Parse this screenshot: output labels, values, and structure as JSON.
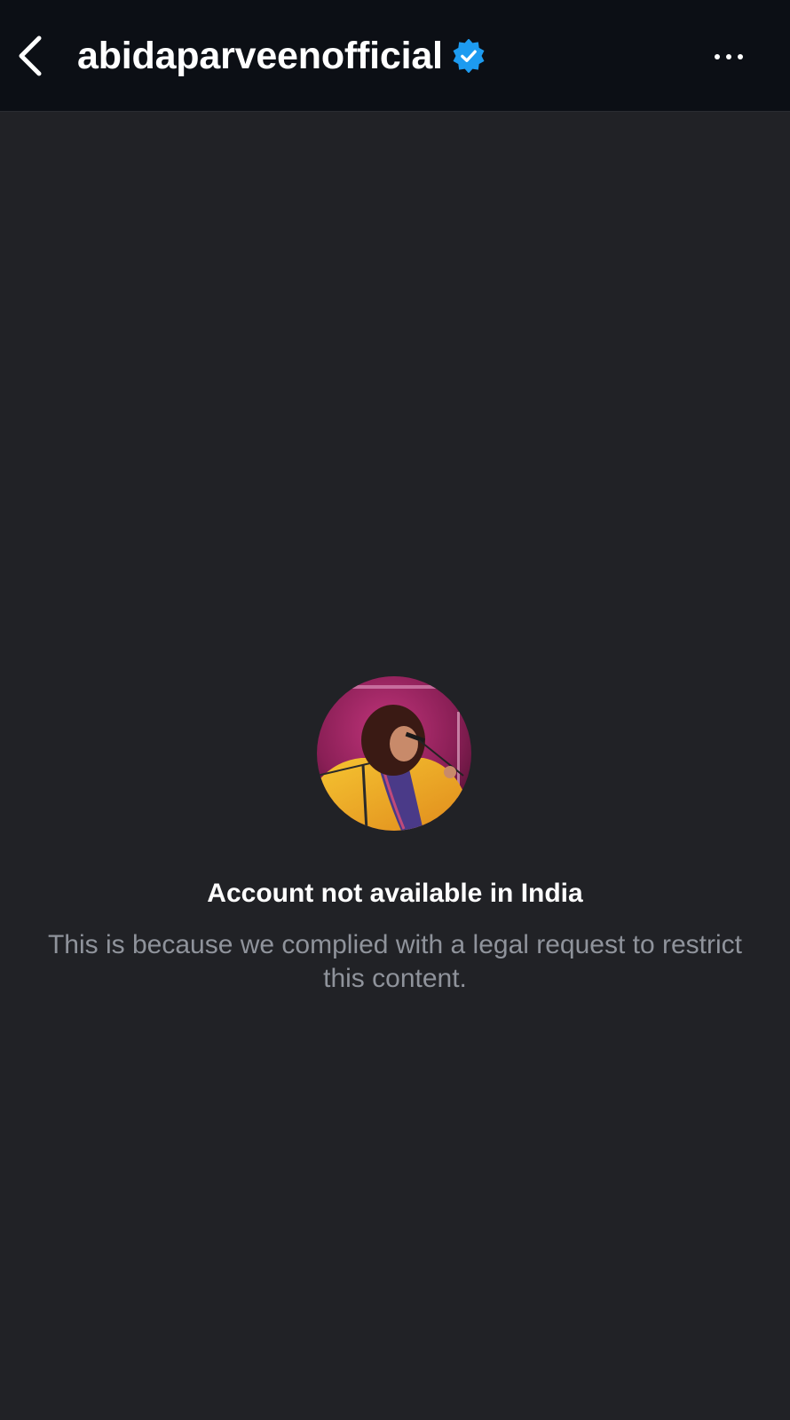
{
  "header": {
    "username": "abidaparveenofficial",
    "verified": true,
    "back_icon": "chevron-left-icon",
    "more_icon": "more-horizontal-icon"
  },
  "profile": {
    "avatar_description": "avatar"
  },
  "notice": {
    "title": "Account not available in India",
    "body": "This is because we complied with a legal request to restrict this content."
  },
  "colors": {
    "background": "#212226",
    "header_background": "#0c0f15",
    "verified_badge": "#1d9bf0",
    "title_text": "#ffffff",
    "body_text": "#8f939b"
  }
}
